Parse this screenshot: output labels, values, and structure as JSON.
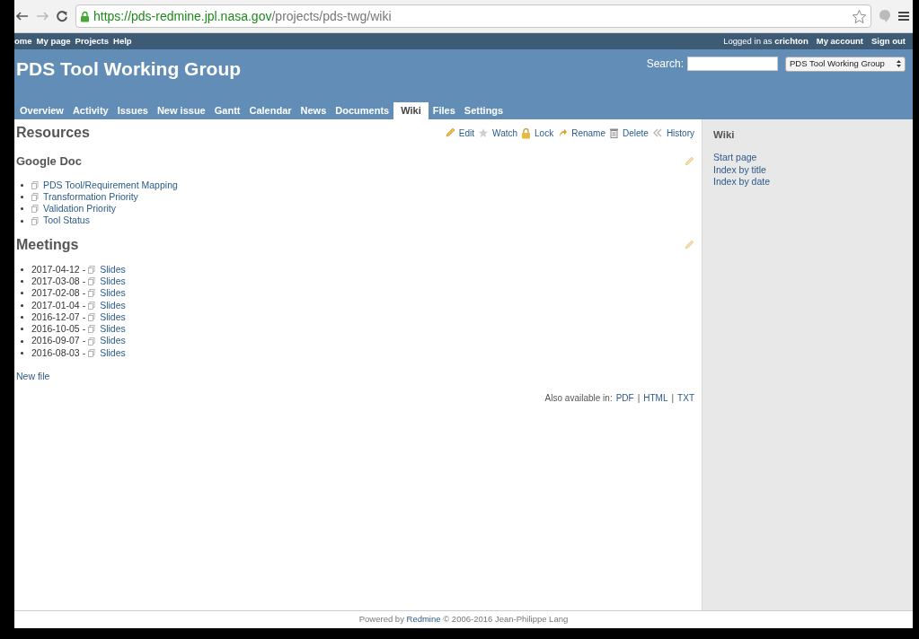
{
  "browser": {
    "url_host": "https://pds-redmine.jpl.nasa.gov",
    "url_path": "/projects/pds-twg/wiki"
  },
  "top_menu": {
    "left": [
      "ome",
      "My page",
      "Projects",
      "Help"
    ],
    "logged_in_label": "Logged in as",
    "user": "crichton",
    "right": [
      "My account",
      "Sign out"
    ]
  },
  "header": {
    "title": "PDS Tool Working Group",
    "search_label": "Search:",
    "project_select": "PDS Tool Working Group"
  },
  "tabs": [
    {
      "label": "Overview",
      "selected": false
    },
    {
      "label": "Activity",
      "selected": false
    },
    {
      "label": "Issues",
      "selected": false
    },
    {
      "label": "New issue",
      "selected": false
    },
    {
      "label": "Gantt",
      "selected": false
    },
    {
      "label": "Calendar",
      "selected": false
    },
    {
      "label": "News",
      "selected": false
    },
    {
      "label": "Documents",
      "selected": false
    },
    {
      "label": "Wiki",
      "selected": true
    },
    {
      "label": "Files",
      "selected": false
    },
    {
      "label": "Settings",
      "selected": false
    }
  ],
  "page": {
    "title": "Resources",
    "actions": [
      {
        "kind": "edit",
        "label": "Edit"
      },
      {
        "kind": "watch",
        "label": "Watch"
      },
      {
        "kind": "lock",
        "label": "Lock"
      },
      {
        "kind": "rename",
        "label": "Rename"
      },
      {
        "kind": "delete",
        "label": "Delete"
      },
      {
        "kind": "history",
        "label": "History"
      }
    ],
    "google_doc": {
      "heading": "Google Doc",
      "links": [
        "PDS Tool/Requirement Mapping",
        "Transformation Priority",
        "Validation Priority",
        "Tool Status"
      ]
    },
    "meetings": {
      "heading": "Meetings",
      "items": [
        {
          "date": "2017-04-12 -",
          "link": "Slides"
        },
        {
          "date": "2017-03-08 -",
          "link": "Slides"
        },
        {
          "date": "2017-02-08 -",
          "link": "Slides"
        },
        {
          "date": "2017-01-04 -",
          "link": "Slides"
        },
        {
          "date": "2016-12-07 -",
          "link": "Slides"
        },
        {
          "date": "2016-10-05 -",
          "link": "Slides"
        },
        {
          "date": "2016-09-07 -",
          "link": "Slides"
        },
        {
          "date": "2016-08-03 -",
          "link": "Slides"
        }
      ]
    },
    "new_file": "New file",
    "also_available": {
      "label": "Also available in:",
      "separator": "|",
      "formats": [
        "PDF",
        "HTML",
        "TXT"
      ]
    }
  },
  "sidebar": {
    "heading": "Wiki",
    "links": [
      "Start page",
      "Index by title",
      "Index by date"
    ]
  },
  "footer": {
    "prefix": "Powered by",
    "link": "Redmine",
    "suffix": "© 2006-2016 Jean-Philippe Lang"
  }
}
